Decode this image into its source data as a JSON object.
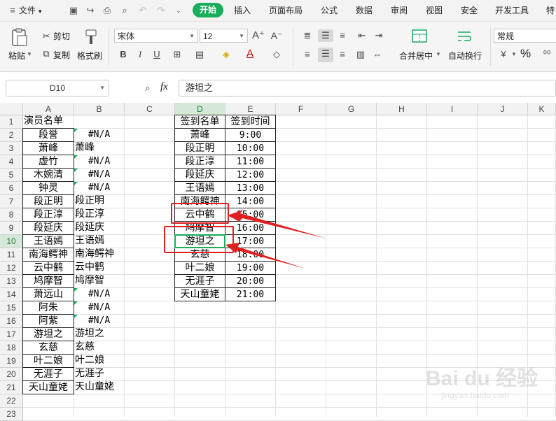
{
  "menubar": {
    "file_label": "文件",
    "tabs": [
      "开始",
      "插入",
      "页面布局",
      "公式",
      "数据",
      "审阅",
      "视图",
      "安全",
      "开发工具",
      "特"
    ]
  },
  "ribbon": {
    "paste": "粘贴",
    "cut": "剪切",
    "copy": "复制",
    "format_painter": "格式刷",
    "font_name": "宋体",
    "font_size": "12",
    "merge_center": "合并居中",
    "wrap_text": "自动换行",
    "number_format": "常规",
    "percent": "%"
  },
  "formula_bar": {
    "name_box": "D10",
    "fx": "fx",
    "content": "游坦之"
  },
  "columns": [
    "A",
    "B",
    "C",
    "D",
    "E",
    "F",
    "G",
    "H",
    "I",
    "J",
    "K"
  ],
  "rows": [
    "1",
    "2",
    "3",
    "4",
    "5",
    "6",
    "7",
    "8",
    "9",
    "10",
    "11",
    "12",
    "13",
    "14",
    "15",
    "16",
    "17",
    "18",
    "19",
    "20",
    "21",
    "22",
    "23"
  ],
  "sheet": {
    "A": [
      "演员名单",
      "段誉",
      "萧峰",
      "虚竹",
      "木婉清",
      "钟灵",
      "段正明",
      "段正淳",
      "段延庆",
      "王语嫣",
      "南海鳄神",
      "云中鹤",
      "鸠摩智",
      "萧远山",
      "阿朱",
      "阿紫",
      "游坦之",
      "玄慈",
      "叶二娘",
      "无涯子",
      "天山童姥"
    ],
    "B": [
      "",
      "#N/A",
      "萧峰",
      "#N/A",
      "#N/A",
      "#N/A",
      "段正明",
      "段正淳",
      "段延庆",
      "王语嫣",
      "南海鳄神",
      "云中鹤",
      "鸠摩智",
      "#N/A",
      "#N/A",
      "#N/A",
      "游坦之",
      "玄慈",
      "叶二娘",
      "无涯子",
      "天山童姥"
    ],
    "D": [
      "签到名单",
      "萧峰",
      "段正明",
      "段正淳",
      "段延庆",
      "王语嫣",
      "南海鳄神",
      "云中鹤",
      "鸠摩智",
      "游坦之",
      "玄慈",
      "叶二娘",
      "无涯子",
      "天山童姥"
    ],
    "E": [
      "签到时间",
      "9:00",
      "10:00",
      "11:00",
      "12:00",
      "13:00",
      "14:00",
      "15:00",
      "16:00",
      "17:00",
      "18:00",
      "19:00",
      "20:00",
      "21:00"
    ]
  },
  "selected_cell": "D10",
  "watermark": {
    "brand": "Bai du 经验",
    "site": "jingyan.baidu.com"
  },
  "colors": {
    "accent": "#1aad5b",
    "annotation": "#e02020"
  }
}
